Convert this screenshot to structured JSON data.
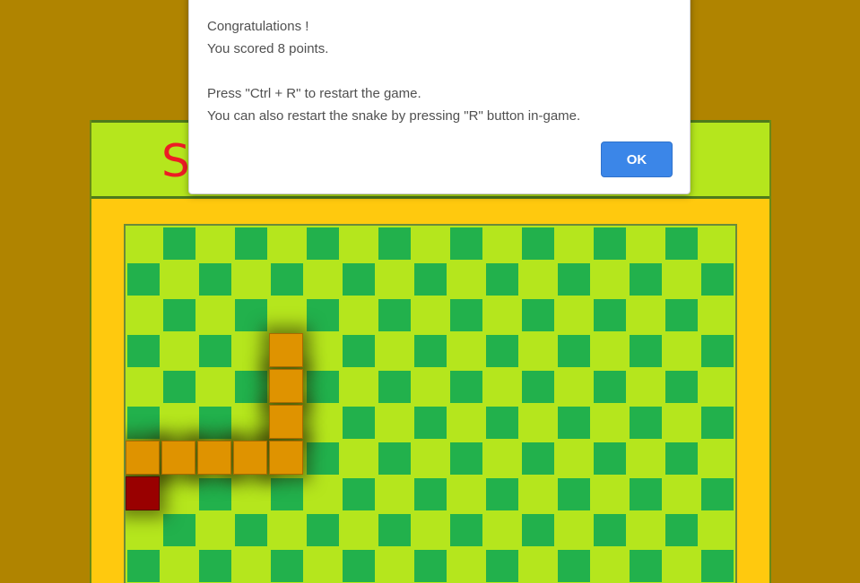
{
  "colors": {
    "page_background": "#b08400",
    "frame_background": "#ffc90e",
    "header_background": "#b5e61d",
    "board_light": "#b5e61d",
    "board_dark": "#22b14c",
    "snake_body": "#df9300",
    "snake_tail": "#990000",
    "title_color": "#ed1c24",
    "ok_button": "#3b86e8"
  },
  "game": {
    "title": "S",
    "board": {
      "cols": 17,
      "rows": 10,
      "snake": [
        {
          "col": 4,
          "row": 3
        },
        {
          "col": 4,
          "row": 4
        },
        {
          "col": 4,
          "row": 5
        },
        {
          "col": 4,
          "row": 6
        },
        {
          "col": 3,
          "row": 6
        },
        {
          "col": 2,
          "row": 6
        },
        {
          "col": 1,
          "row": 6
        },
        {
          "col": 0,
          "row": 6
        },
        {
          "col": 0,
          "row": 7,
          "tail": true
        }
      ]
    }
  },
  "dialog": {
    "lines": [
      "Congratulations !",
      "You scored 8 points.",
      "",
      "Press \"Ctrl + R\" to restart the game.",
      "You can also restart the snake by pressing \"R\" button in-game."
    ],
    "ok_label": "OK"
  }
}
